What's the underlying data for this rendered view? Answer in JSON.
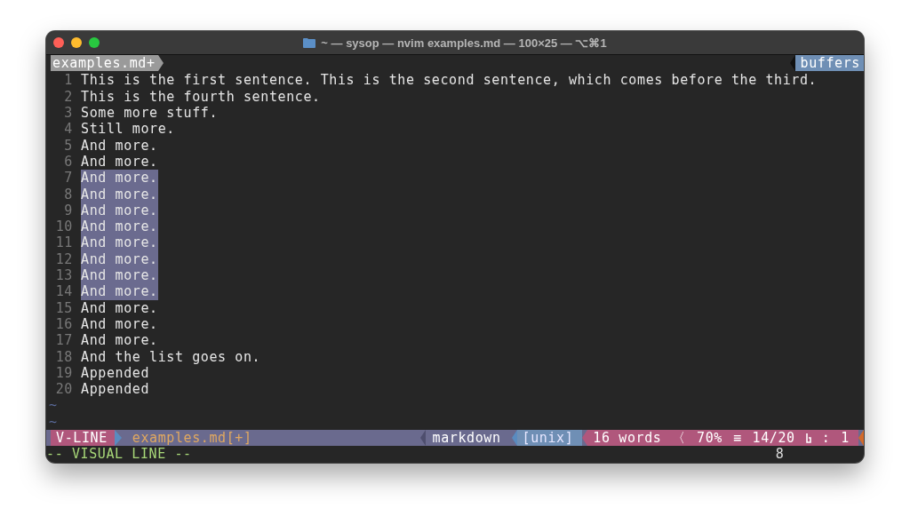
{
  "window": {
    "title": "~ — sysop — nvim examples.md — 100×25 — ⌥⌘1"
  },
  "tabline": {
    "tabs": [
      {
        "label": "examples.md+",
        "selected": true
      }
    ],
    "right_label": "buffers"
  },
  "lines": [
    {
      "number": "1",
      "text": "This is the first sentence. This is the second sentence, which comes before the third.",
      "selected": false
    },
    {
      "number": "2",
      "text": "This is the fourth sentence.",
      "selected": false
    },
    {
      "number": "3",
      "text": "Some more stuff.",
      "selected": false
    },
    {
      "number": "4",
      "text": "Still more.",
      "selected": false
    },
    {
      "number": "5",
      "text": "And more.",
      "selected": false
    },
    {
      "number": "6",
      "text": "And more.",
      "selected": false
    },
    {
      "number": "7",
      "text": "And more.",
      "selected": true
    },
    {
      "number": "8",
      "text": "And more.",
      "selected": true
    },
    {
      "number": "9",
      "text": "And more.",
      "selected": true
    },
    {
      "number": "10",
      "text": "And more.",
      "selected": true
    },
    {
      "number": "11",
      "text": "And more.",
      "selected": true
    },
    {
      "number": "12",
      "text": "And more.",
      "selected": true
    },
    {
      "number": "13",
      "text": "And more.",
      "selected": true
    },
    {
      "number": "14",
      "text": "And more.",
      "selected": true
    },
    {
      "number": "15",
      "text": "And more.",
      "selected": false
    },
    {
      "number": "16",
      "text": "And more.",
      "selected": false
    },
    {
      "number": "17",
      "text": "And more.",
      "selected": false
    },
    {
      "number": "18",
      "text": "And the list goes on.",
      "selected": false
    },
    {
      "number": "19",
      "text": "Appended",
      "selected": false
    },
    {
      "number": "20",
      "text": "Appended",
      "selected": false
    }
  ],
  "tildes": [
    "~",
    "~"
  ],
  "statusline": {
    "mode": "V-LINE",
    "file": "examples.md[+]",
    "filetype": "markdown",
    "format": "[unix]",
    "segments": [
      {
        "kind": "text",
        "text": "16 words"
      },
      {
        "kind": "text",
        "text": "〈"
      },
      {
        "kind": "text",
        "text": "70%"
      },
      {
        "kind": "text",
        "text": "≡"
      },
      {
        "kind": "text",
        "text": "14/20"
      },
      {
        "kind": "ln-icon"
      },
      {
        "kind": "text",
        "text": ":"
      },
      {
        "kind": "text",
        "text": "1"
      }
    ]
  },
  "cmdline": {
    "message": "-- VISUAL LINE --",
    "count": "8"
  }
}
